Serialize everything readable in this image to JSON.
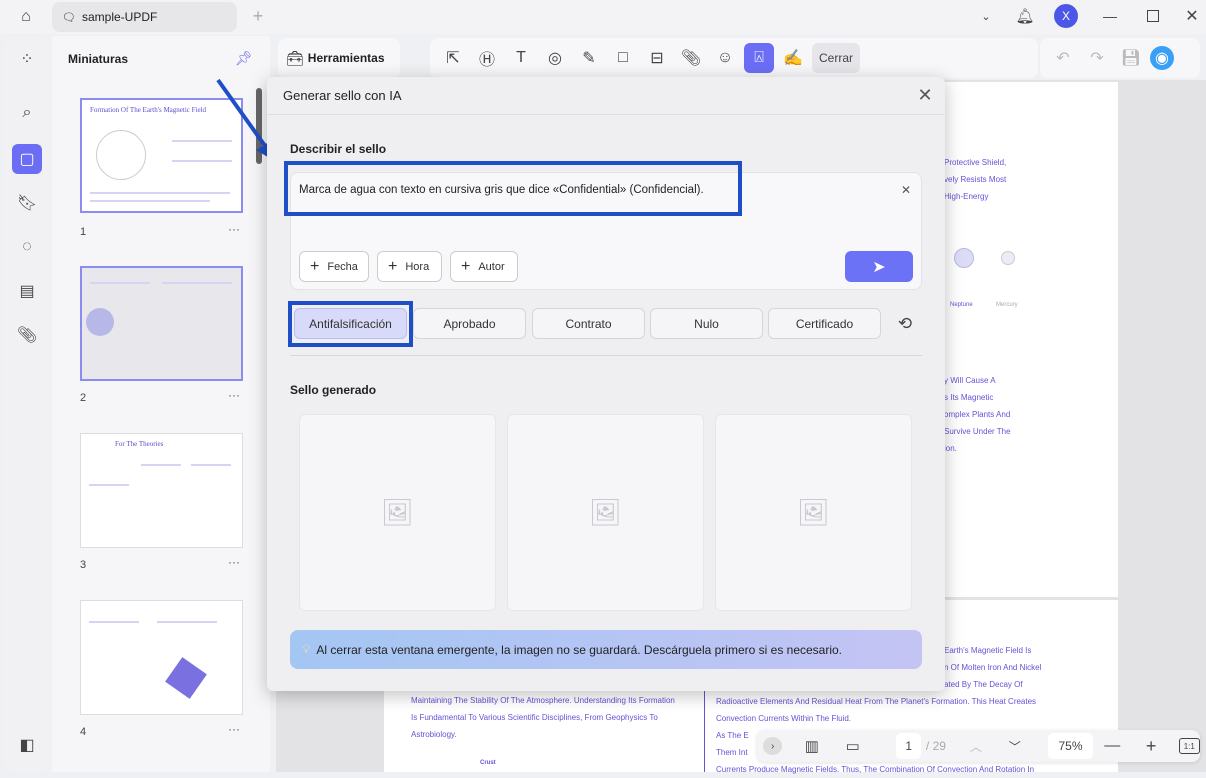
{
  "titlebar": {
    "tab_title": "sample-UPDF",
    "avatar_letter": "X"
  },
  "thumbnails": {
    "title": "Miniaturas",
    "pages": [
      {
        "num": "1",
        "title": "Formation Of The Earth's Magnetic Field"
      },
      {
        "num": "2",
        "title": ""
      },
      {
        "num": "3",
        "title": "For The Theories"
      },
      {
        "num": "4",
        "title": ""
      }
    ]
  },
  "toolbar": {
    "tools_label": "Herramientas",
    "close_label": "Cerrar"
  },
  "dialog": {
    "title": "Generar sello con IA",
    "describe_label": "Describir el sello",
    "prompt_value": "Marca de agua con texto en cursiva gris que dice «Confidential» (Confidencial).",
    "chips": [
      "Fecha",
      "Hora",
      "Autor"
    ],
    "categories": [
      "Antifalsificación",
      "Aprobado",
      "Contrato",
      "Nulo",
      "Certificado"
    ],
    "selected_category": "Antifalsificación",
    "generated_label": "Sello generado",
    "notice": "Al cerrar esta ventana emergente, la imagen no se guardará. Descárguela primero si es necesario."
  },
  "document": {
    "right_lines_top": [
      "Protective Shield,",
      "vely Resists Most",
      "High-Energy"
    ],
    "planet_labels": [
      "Neptune",
      "Mercury"
    ],
    "right_lines_mid": [
      "y Will Cause A",
      "s Its Magnetic",
      "omplex Plants And",
      "Survive Under The",
      "ion."
    ],
    "right_lines_low": [
      "Earth's Magnetic Field Is",
      "n Of Molten Iron And Nickel",
      "ated By The Decay Of",
      "Radioactive Elements And Residual Heat From The Planet's Formation. This Heat Creates",
      "Convection Currents Within The Fluid.",
      "As The E",
      "Them Int",
      "Currents Produce Magnetic Fields. Thus, The Combination Of Convection And Rotation In"
    ],
    "left_lines": [
      "Maintaining The Stability Of The Atmosphere. Understanding Its Formation",
      "Is Fundamental To Various Scientific Disciplines, From Geophysics To",
      "Astrobiology."
    ],
    "crust_label": "Crust"
  },
  "bottom_nav": {
    "current_page": "1",
    "total_pages": "/ 29",
    "zoom": "75%",
    "fit_label": "1:1"
  }
}
